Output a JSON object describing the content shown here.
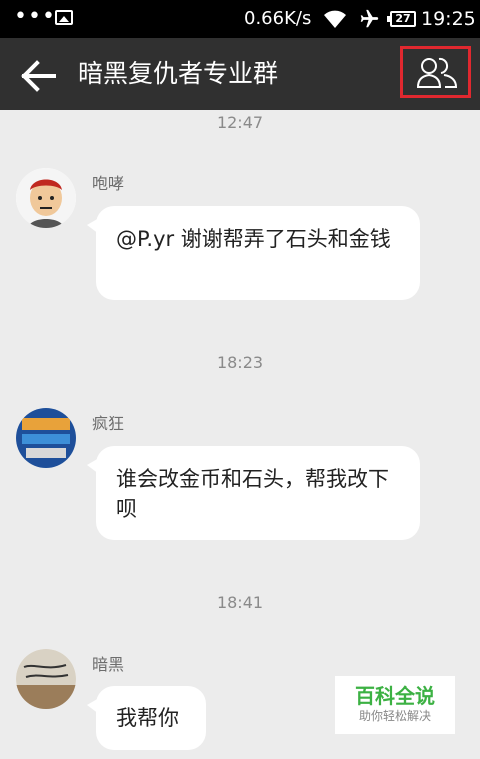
{
  "status_bar": {
    "dots": "•••",
    "speed": "0.66K/s",
    "battery": "27",
    "time": "19:25"
  },
  "header": {
    "title": "暗黑复仇者专业群"
  },
  "messages": [
    {
      "time": "12:47",
      "sender": "咆哮",
      "text": "@P.yr 谢谢帮弄了石头和金钱"
    },
    {
      "time": "18:23",
      "sender": "疯狂",
      "text": "谁会改金币和石头，帮我改下呗"
    },
    {
      "time": "18:41",
      "sender": "暗黑",
      "text": "我帮你"
    }
  ],
  "watermark": {
    "title": "百科全说",
    "subtitle": "助你轻松解决"
  },
  "colors": {
    "status_bar": "#000000",
    "title_bar": "#303030",
    "background": "#ececec",
    "highlight": "#e0282f",
    "watermark_green": "#3cb143"
  },
  "icons": [
    "image-icon",
    "wifi-icon",
    "airplane-icon",
    "battery-icon",
    "back-arrow-icon",
    "group-members-icon"
  ]
}
